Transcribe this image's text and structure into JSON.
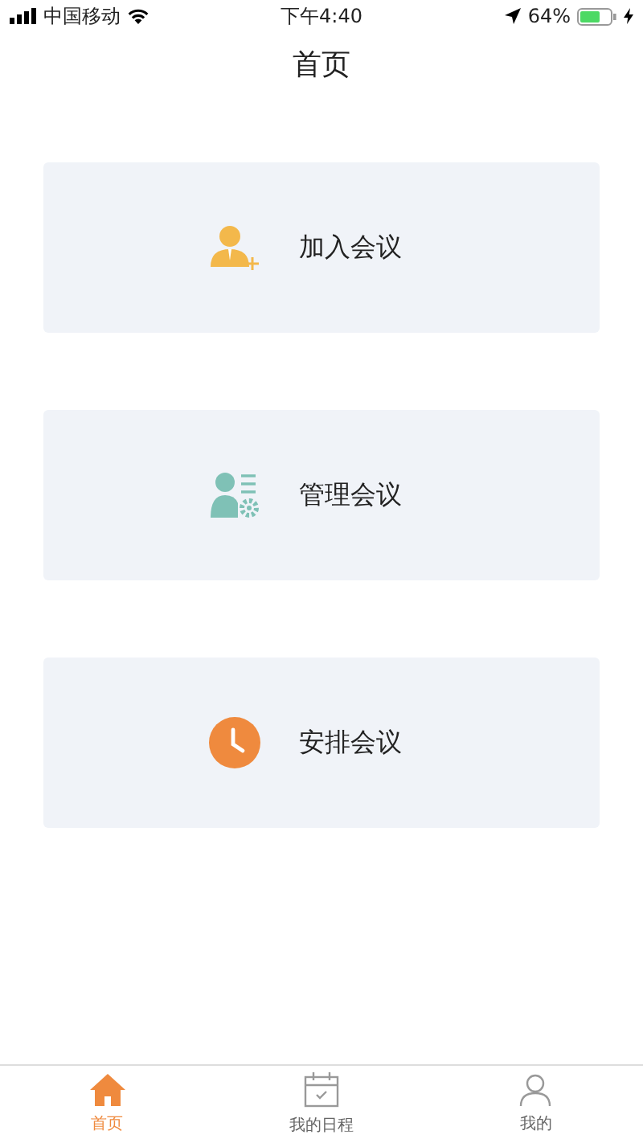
{
  "status_bar": {
    "carrier": "中国移动",
    "time": "下午4:40",
    "battery": "64%"
  },
  "header": {
    "title": "首页"
  },
  "cards": [
    {
      "kind": "join",
      "label": "加入会议"
    },
    {
      "kind": "manage",
      "label": "管理会议"
    },
    {
      "kind": "schedule",
      "label": "安排会议"
    }
  ],
  "tabs": [
    {
      "kind": "home",
      "label": "首页",
      "selected": true
    },
    {
      "kind": "calendar",
      "label": "我的日程",
      "selected": false
    },
    {
      "kind": "person",
      "label": "我的",
      "selected": false
    }
  ]
}
